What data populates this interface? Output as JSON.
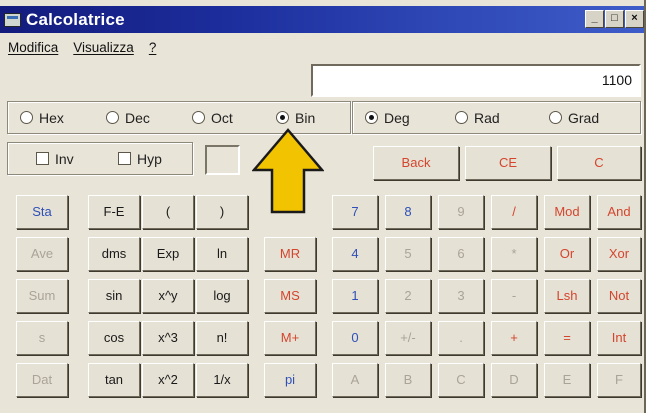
{
  "window": {
    "title": "Calcolatrice",
    "controls": [
      "_",
      "□",
      "×"
    ]
  },
  "menu": [
    "Modifica",
    "Visualizza",
    "?"
  ],
  "display": {
    "value": "1100"
  },
  "base_options": [
    {
      "label": "Hex",
      "selected": false
    },
    {
      "label": "Dec",
      "selected": false
    },
    {
      "label": "Oct",
      "selected": false
    },
    {
      "label": "Bin",
      "selected": true
    }
  ],
  "angle_options": [
    {
      "label": "Deg",
      "selected": true
    },
    {
      "label": "Rad",
      "selected": false
    },
    {
      "label": "Grad",
      "selected": false
    }
  ],
  "checkboxes": [
    {
      "label": "Inv",
      "checked": false
    },
    {
      "label": "Hyp",
      "checked": false
    }
  ],
  "control_buttons": [
    "Back",
    "CE",
    "C"
  ],
  "stat_buttons": [
    "Sta",
    "Ave",
    "Sum",
    "s",
    "Dat"
  ],
  "sci_buttons": [
    [
      "F-E",
      "(",
      ")"
    ],
    [
      "dms",
      "Exp",
      "ln"
    ],
    [
      "sin",
      "x^y",
      "log"
    ],
    [
      "cos",
      "x^3",
      "n!"
    ],
    [
      "tan",
      "x^2",
      "1/x"
    ]
  ],
  "memory_buttons": [
    "MR",
    "MS",
    "M+",
    "pi"
  ],
  "keypad": [
    [
      "7",
      "8",
      "9",
      "/",
      "Mod",
      "And"
    ],
    [
      "4",
      "5",
      "6",
      "*",
      "Or",
      "Xor"
    ],
    [
      "1",
      "2",
      "3",
      "-",
      "Lsh",
      "Not"
    ],
    [
      "0",
      "+/-",
      ".",
      "+",
      "=",
      "Int"
    ],
    [
      "A",
      "B",
      "C",
      "D",
      "E",
      "F"
    ]
  ],
  "highlight_arrow": {
    "color": "#f2c300",
    "icon": "up-arrow-icon"
  }
}
